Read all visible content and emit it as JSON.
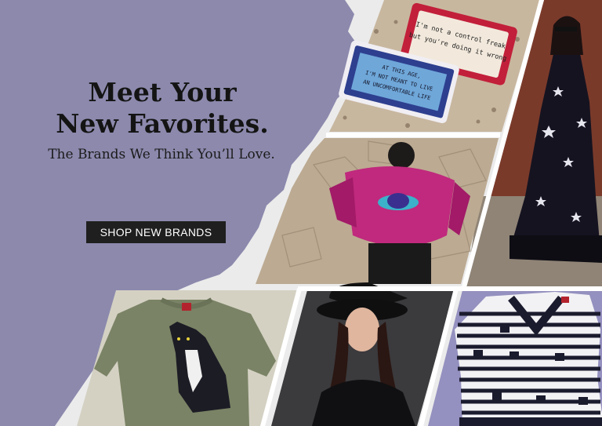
{
  "hero": {
    "headline_line1": "Meet Your",
    "headline_line2": "New Favorites.",
    "subheadline": "The Brands We Think You’ll Love.",
    "cta_label": "SHOP NEW BRANDS"
  },
  "pillows": {
    "pillow1_line1": "I'm not a control freak",
    "pillow1_line2": "but you're doing it wrong",
    "pillow2_line1": "AT THIS AGE,",
    "pillow2_line2": "I'M NOT MEANT TO LIVE",
    "pillow2_line3": "AN UNCOMFORTABLE LIFE"
  },
  "colors": {
    "background": "#8c89ad",
    "cta_background": "#1f1f1f",
    "cta_text": "#ffffff",
    "headline": "#141414"
  }
}
